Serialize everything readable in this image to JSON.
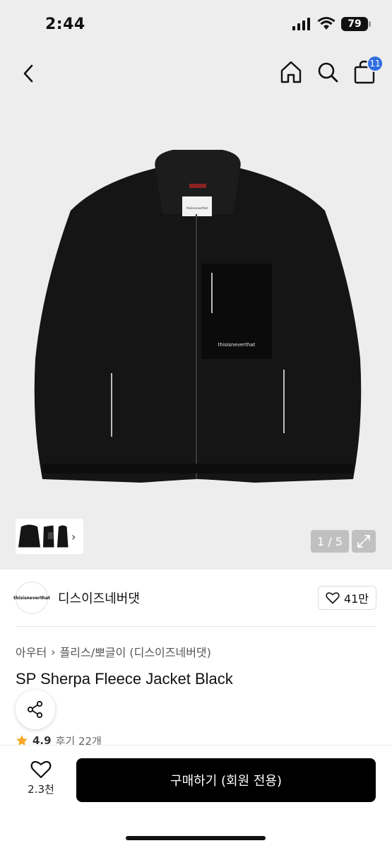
{
  "status_bar": {
    "time": "2:44",
    "battery": "79"
  },
  "header": {
    "back_icon": "chevron-left-icon",
    "icons": [
      "home-icon",
      "search-icon",
      "bag-icon"
    ],
    "cart_count": "11"
  },
  "gallery": {
    "pager": "1 / 5",
    "thumb_arrow": "›"
  },
  "brand": {
    "logo_text": "thisisneverthat",
    "name": "디스이즈네버댓",
    "like_count": "41만"
  },
  "breadcrumb": {
    "category": "아우터",
    "separator": "›",
    "subcategory": "플리스/뽀글이 (디스이즈네버댓)"
  },
  "product": {
    "title": "SP Sherpa Fleece Jacket Black",
    "rating": "4.9",
    "review_label": "후기 22개"
  },
  "jacket_labels": {
    "pocket_print": "thisisneverthat",
    "neck_tag": "thisisneverthat"
  },
  "bottom_bar": {
    "wish_count": "2.3천",
    "buy_label": "구매하기 (회원 전용)"
  },
  "colors": {
    "accent": "#2f6de1",
    "star": "#f5a623",
    "buy_button": "#000000"
  }
}
